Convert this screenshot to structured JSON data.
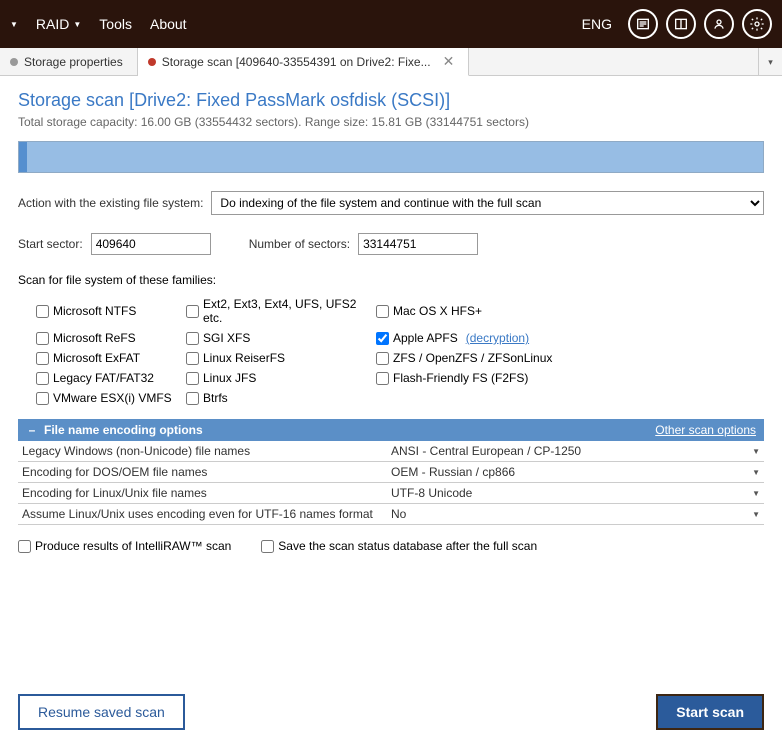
{
  "topbar": {
    "menu": [
      "RAID",
      "Tools",
      "About"
    ],
    "language": "ENG"
  },
  "tabs": {
    "storage_properties": "Storage properties",
    "storage_scan": "Storage scan [409640-33554391 on Drive2: Fixe..."
  },
  "page_title": "Storage scan [Drive2: Fixed PassMark osfdisk (SCSI)]",
  "subtitle": "Total storage capacity: 16.00 GB (33554432 sectors). Range size: 15.81 GB (33144751 sectors)",
  "action": {
    "label": "Action with the existing file system:",
    "value": "Do indexing of the file system and continue with the full scan"
  },
  "sectors": {
    "start_label": "Start sector:",
    "start_value": "409640",
    "count_label": "Number of sectors:",
    "count_value": "33144751"
  },
  "fs_heading": "Scan for file system of these families:",
  "fs": {
    "c0": [
      "Microsoft NTFS",
      "Microsoft ReFS",
      "Microsoft ExFAT",
      "Legacy FAT/FAT32",
      "VMware ESX(i) VMFS"
    ],
    "c1": [
      "Ext2, Ext3, Ext4, UFS, UFS2 etc.",
      "SGI XFS",
      "Linux ReiserFS",
      "Linux JFS",
      "Btrfs"
    ],
    "c2": [
      "Mac OS X HFS+",
      "Apple APFS",
      "ZFS / OpenZFS / ZFSonLinux",
      "Flash-Friendly FS (F2FS)"
    ],
    "decrypt_link": "(decryption)"
  },
  "encoding_section": {
    "title": "File name encoding options",
    "other_link": "Other scan options",
    "rows": [
      {
        "label": "Legacy Windows (non-Unicode) file names",
        "value": "ANSI - Central European / CP-1250"
      },
      {
        "label": "Encoding for DOS/OEM file names",
        "value": "OEM - Russian / cp866"
      },
      {
        "label": "Encoding for Linux/Unix file names",
        "value": "UTF-8 Unicode"
      },
      {
        "label": "Assume Linux/Unix uses encoding even for UTF-16 names format",
        "value": "No"
      }
    ]
  },
  "bottom": {
    "intelliraw": "Produce results of IntelliRAW™ scan",
    "save_db": "Save the scan status database after the full scan"
  },
  "footer": {
    "resume": "Resume saved scan",
    "start": "Start scan"
  }
}
